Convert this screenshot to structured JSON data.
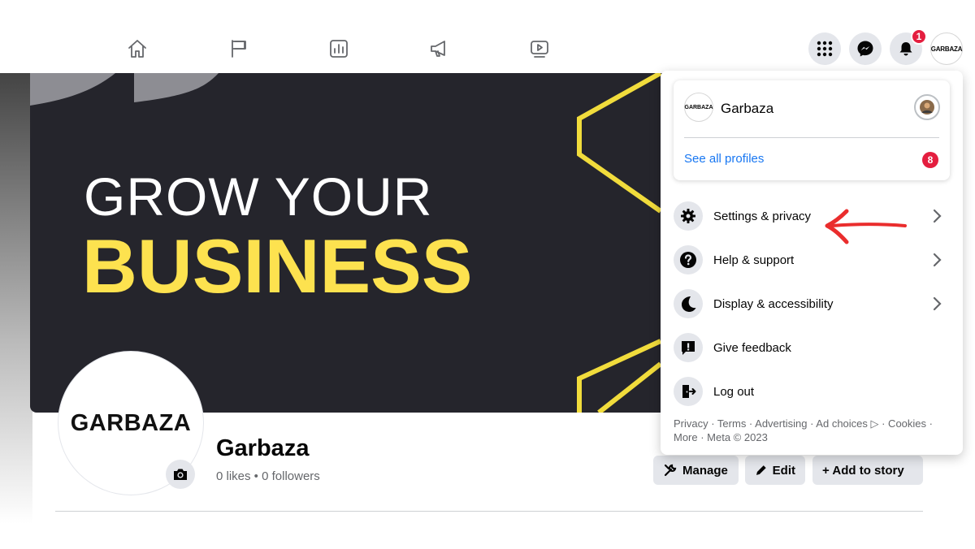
{
  "header": {
    "nav": [
      "home-icon",
      "flag-icon",
      "insights-icon",
      "megaphone-icon",
      "video-icon"
    ],
    "notification_count": "1",
    "avatar_text": "GARBAZA"
  },
  "cover": {
    "line1": "GROW YOUR",
    "line2": "BUSINESS",
    "accent_color": "#fde24f"
  },
  "profile": {
    "logo_text": "GARBAZA",
    "name": "Garbaza",
    "stats": "0 likes • 0 followers",
    "buttons": {
      "manage": "Manage",
      "edit": "Edit",
      "add_story": "+ Add to story"
    }
  },
  "menu": {
    "card": {
      "avatar_text": "GARBAZA",
      "name": "Garbaza",
      "see_all": "See all profiles",
      "see_all_count": "8"
    },
    "items": [
      {
        "label": "Settings & privacy",
        "icon": "gear-icon"
      },
      {
        "label": "Help & support",
        "icon": "question-icon"
      },
      {
        "label": "Display & accessibility",
        "icon": "moon-icon"
      },
      {
        "label": "Give feedback",
        "icon": "feedback-icon"
      },
      {
        "label": "Log out",
        "icon": "logout-icon"
      }
    ],
    "footer": "Privacy · Terms · Advertising · Ad choices ▷ · Cookies · More · Meta © 2023"
  }
}
